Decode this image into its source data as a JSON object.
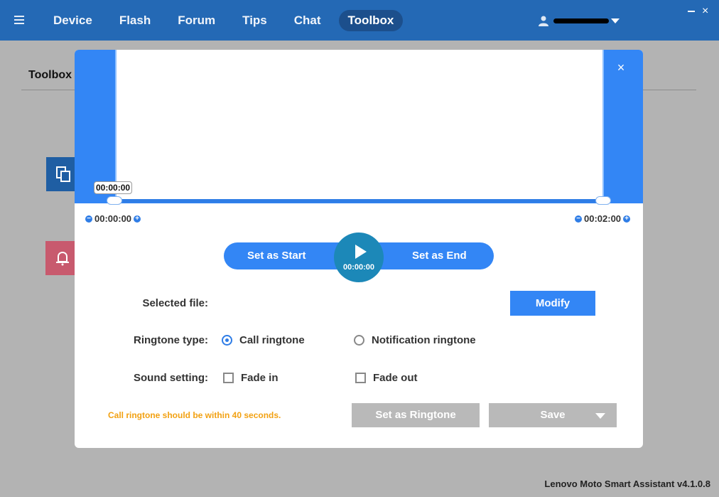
{
  "nav": {
    "items": [
      {
        "label": "Device"
      },
      {
        "label": "Flash"
      },
      {
        "label": "Forum"
      },
      {
        "label": "Tips"
      },
      {
        "label": "Chat"
      },
      {
        "label": "Toolbox"
      }
    ],
    "active": "Toolbox"
  },
  "background": {
    "heading": "Toolbox",
    "version": "Lenovo Moto Smart Assistant v4.1.0.8"
  },
  "modal": {
    "tooltip_time": "00:00:00",
    "start_time": "00:00:00",
    "end_time": "00:02:00",
    "decrement_symbol": "−",
    "increment_symbol": "+",
    "set_start_label": "Set as Start",
    "set_end_label": "Set as End",
    "play_time": "00:00:00",
    "selected_file_label": "Selected file:",
    "modify_label": "Modify",
    "ringtone_type_label": "Ringtone type:",
    "call_ringtone_label": "Call ringtone",
    "notification_ringtone_label": "Notification ringtone",
    "selected_ringtone_type": "Call ringtone",
    "sound_setting_label": "Sound setting:",
    "fade_in_label": "Fade in",
    "fade_out_label": "Fade out",
    "fade_in_checked": false,
    "fade_out_checked": false,
    "warning": "Call ringtone should be within 40 seconds.",
    "set_ringtone_label": "Set as Ringtone",
    "save_label": "Save",
    "close_symbol": "×"
  },
  "colors": {
    "topbar": "#2469b5",
    "accent": "#3386f5",
    "play": "#1c88b8",
    "warning": "#f2a112",
    "disabled": "#b9b9b9"
  },
  "icons": [
    "menu-icon",
    "user-icon",
    "dropdown-caret-icon",
    "minimize-icon",
    "close-icon",
    "copy-icon",
    "bell-icon",
    "play-icon"
  ]
}
